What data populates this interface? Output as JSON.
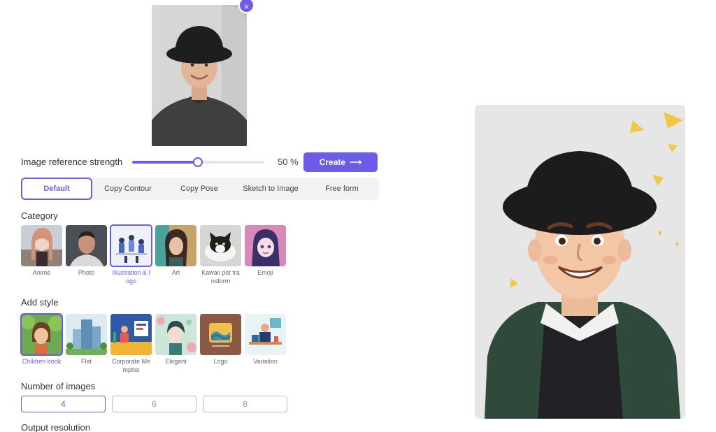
{
  "upload": {
    "remove_label": "×",
    "alt": "Uploaded reference photo of a young man with curly hair wearing a black hat"
  },
  "strength": {
    "label": "Image reference strength",
    "value_text": "50 %",
    "value": 0.5
  },
  "create": {
    "label": "Create",
    "arrow": "⟶"
  },
  "tabs": [
    {
      "label": "Default",
      "active": true
    },
    {
      "label": "Copy Contour",
      "active": false
    },
    {
      "label": "Copy Pose",
      "active": false
    },
    {
      "label": "Sketch to Image",
      "active": false
    },
    {
      "label": "Free form",
      "active": false
    }
  ],
  "category": {
    "label": "Category",
    "items": [
      {
        "label": "Anime",
        "selected": false
      },
      {
        "label": "Photo",
        "selected": false
      },
      {
        "label": "Illustration & l ogo",
        "selected": true
      },
      {
        "label": "Art",
        "selected": false
      },
      {
        "label": "Kawaii pet tra nsform",
        "selected": false
      },
      {
        "label": "Emoji",
        "selected": false
      }
    ]
  },
  "style": {
    "label": "Add style",
    "items": [
      {
        "label": "Children book",
        "selected": true
      },
      {
        "label": "Flat",
        "selected": false
      },
      {
        "label": "Corporate Me mphis",
        "selected": false
      },
      {
        "label": "Elegant",
        "selected": false
      },
      {
        "label": "Logo",
        "selected": false
      },
      {
        "label": "Variation",
        "selected": false
      }
    ]
  },
  "count": {
    "label": "Number of images",
    "options": [
      "4",
      "6",
      "8"
    ],
    "selected": "4"
  },
  "resolution": {
    "label": "Output resolution"
  },
  "colors": {
    "accent": "#6c5ce7",
    "text": "#333333",
    "muted": "#999999"
  }
}
